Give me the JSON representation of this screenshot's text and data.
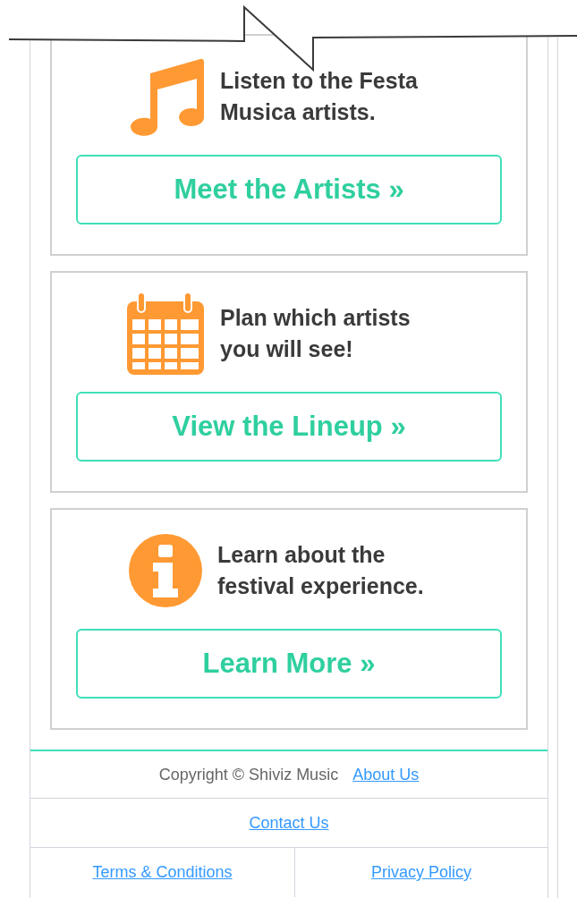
{
  "cards": [
    {
      "kind": "music",
      "text": "Listen to the Festa Musica artists.",
      "button": "Meet the Artists »"
    },
    {
      "kind": "calendar",
      "text": "Plan which artists you will see!",
      "button": "View the Lineup »"
    },
    {
      "kind": "info",
      "text": "Learn about the festival experience.",
      "button": "Learn More »"
    }
  ],
  "footer": {
    "copyright": "Copyright © Shiviz Music",
    "about": "About Us",
    "contact": "Contact Us",
    "terms": "Terms & Conditions",
    "privacy": "Privacy Policy"
  }
}
